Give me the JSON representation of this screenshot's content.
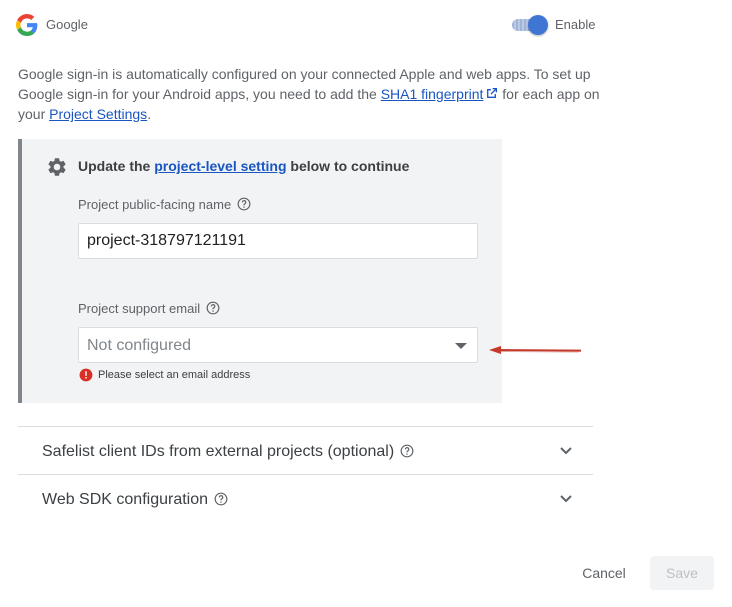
{
  "provider": {
    "name": "Google",
    "icon": "google-g-icon"
  },
  "toggle": {
    "label": "Enable",
    "state": "on",
    "color": "#3f76d4"
  },
  "description": {
    "text_1": "Google sign-in is automatically configured on your connected Apple and web apps. To set up Google sign-in for your Android apps, you need to add the ",
    "link_1": "SHA1 fingerprint",
    "text_2": " for each app on your ",
    "link_2": "Project Settings",
    "text_3": "."
  },
  "update_panel": {
    "title_prefix": "Update the ",
    "title_link": "project-level setting",
    "title_suffix": " below to continue",
    "name_label": "Project public-facing name",
    "name_value": "project-318797121191",
    "email_label": "Project support email",
    "email_value": "Not configured",
    "error_text": "Please select an email address"
  },
  "accordions": [
    {
      "label": "Safelist client IDs from external projects (optional)"
    },
    {
      "label": "Web SDK configuration"
    }
  ],
  "footer": {
    "cancel_label": "Cancel",
    "save_label": "Save"
  },
  "colors": {
    "link": "#1a56c2",
    "error": "#d93025",
    "annotation_arrow": "#c5392b"
  }
}
